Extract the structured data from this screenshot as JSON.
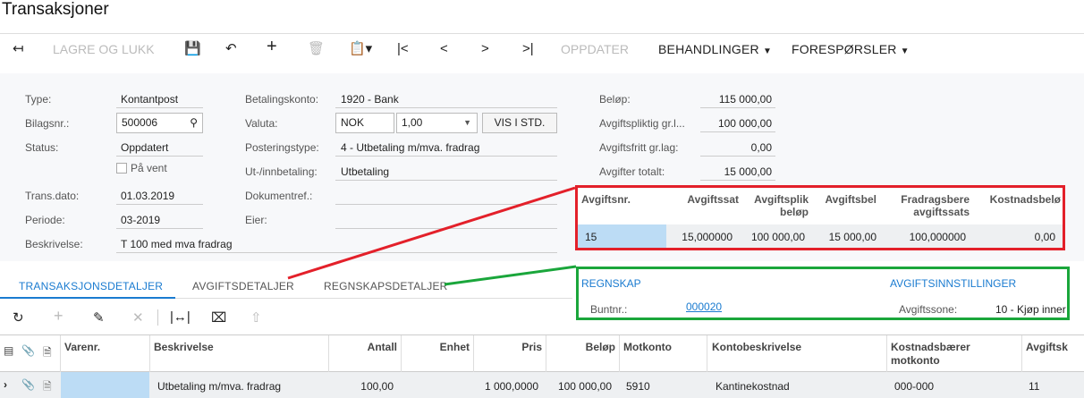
{
  "title": "Transaksjoner",
  "toolbar": {
    "save_close": "LAGRE OG LUKK",
    "refresh": "OPPDATER",
    "actions": "BEHANDLINGER",
    "inquiries": "FORESPØRSLER"
  },
  "form": {
    "type_label": "Type:",
    "type_value": "Kontantpost",
    "doc_label": "Bilagsnr.:",
    "doc_value": "500006",
    "status_label": "Status:",
    "status_value": "Oppdatert",
    "hold_label": "På vent",
    "date_label": "Trans.dato:",
    "date_value": "01.03.2019",
    "period_label": "Periode:",
    "period_value": "03-2019",
    "desc_label": "Beskrivelse:",
    "desc_value": "T 100 med mva fradrag",
    "cash_label": "Betalingskonto:",
    "cash_value": "1920 - Bank",
    "currency_label": "Valuta:",
    "currency_value": "NOK",
    "rate_value": "1,00",
    "view_base": "VIS I STD.",
    "entry_label": "Posteringstype:",
    "entry_value": "4 - Utbetaling m/mva. fradrag",
    "dir_label": "Ut-/innbetaling:",
    "dir_value": "Utbetaling",
    "docref_label": "Dokumentref.:",
    "docref_value": "",
    "owner_label": "Eier:",
    "owner_value": "",
    "amount_label": "Beløp:",
    "amount_value": "115 000,00",
    "taxable_label": "Avgiftspliktig gr.l...",
    "taxable_value": "100 000,00",
    "exempt_label": "Avgiftsfritt gr.lag:",
    "exempt_value": "0,00",
    "taxtotal_label": "Avgifter totalt:",
    "taxtotal_value": "15 000,00"
  },
  "tax_grid": {
    "headers": [
      "Avgiftsnr.",
      "Avgiftssat",
      "Avgiftsplik beløp",
      "Avgiftsbel",
      "Fradragsbere avgiftssats",
      "Kostnadsbelø"
    ],
    "row": [
      "15",
      "15,000000",
      "100 000,00",
      "15 000,00",
      "100,000000",
      "0,00"
    ]
  },
  "tabs": [
    "TRANSAKSJONSDETALJER",
    "AVGIFTSDETALJER",
    "REGNSKAPSDETALJER"
  ],
  "accounting": {
    "section1": "REGNSKAP",
    "section2": "AVGIFTSINNSTILLINGER",
    "batch_label": "Buntnr.:",
    "batch_value": "000020",
    "zone_label": "Avgiftssone:",
    "zone_value": "10 - Kjøp inner"
  },
  "grid": {
    "headers": [
      "Varenr.",
      "Beskrivelse",
      "Antall",
      "Enhet",
      "Pris",
      "Beløp",
      "Motkonto",
      "Kontobeskrivelse",
      "Kostnadsbærer motkonto",
      "Avgiftsk"
    ],
    "row": [
      "",
      "Utbetaling m/mva. fradrag",
      "100,00",
      "",
      "1 000,0000",
      "100 000,00",
      "5910",
      "Kantinekostnad",
      "000-000",
      "11"
    ]
  },
  "colors": {
    "accent": "#1a7bd0",
    "red_highlight": "#e3202a",
    "green_highlight": "#1aa63b"
  }
}
